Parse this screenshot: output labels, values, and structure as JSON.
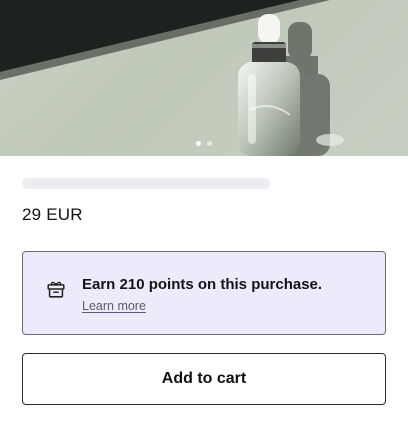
{
  "product": {
    "image_alt": "serum-bottle-photo",
    "carousel": {
      "count": 2,
      "active": 0
    },
    "price": "29 EUR"
  },
  "points": {
    "title": "Earn 210 points on this purchase.",
    "link": "Learn more",
    "icon": "gift-icon"
  },
  "actions": {
    "add_to_cart": "Add to cart"
  },
  "colors": {
    "card_bg": "#ecebfb",
    "card_border": "#6b6a78",
    "skeleton": "#eeebf3"
  }
}
